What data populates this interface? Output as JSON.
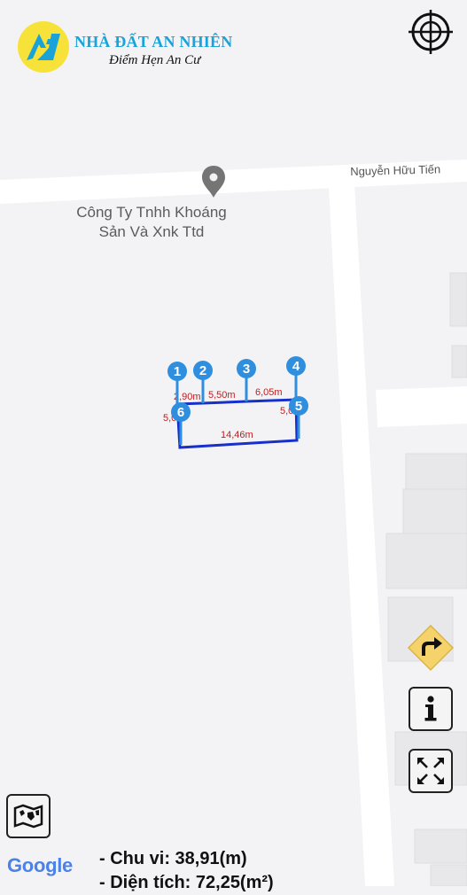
{
  "brand": {
    "name": "NHÀ ĐẤT AN NHIÊN",
    "slogan": "Điểm Hẹn An Cư",
    "badge_color": "#f7e23a",
    "title_color": "#1aa3d9"
  },
  "map": {
    "poi": {
      "line1": "Công Ty Tnhh Khoáng",
      "line2": "Sản Và Xnk Ttd",
      "icon": "place-pin-icon"
    },
    "street": "Nguyễn Hữu Tiến",
    "markers": [
      "1",
      "2",
      "3",
      "4",
      "5",
      "6"
    ],
    "segments": [
      "2,90m",
      "5,50m",
      "6,05m",
      "5,0m",
      "5,0m",
      "14,46m"
    ],
    "parcel_color": "#1730c9",
    "marker_color": "#2f8fde",
    "label_color": "#c31c1c"
  },
  "controls": {
    "locate": "crosshair-icon",
    "direction": "turn-right-icon",
    "info": "info-icon",
    "fullscreen": "expand-icon",
    "map_type": "map-icon"
  },
  "google": {
    "text": "Google"
  },
  "measurements": {
    "perimeter": "- Chu vi: 38,91(m)",
    "area": "- Diện tích: 72,25(m²)"
  }
}
